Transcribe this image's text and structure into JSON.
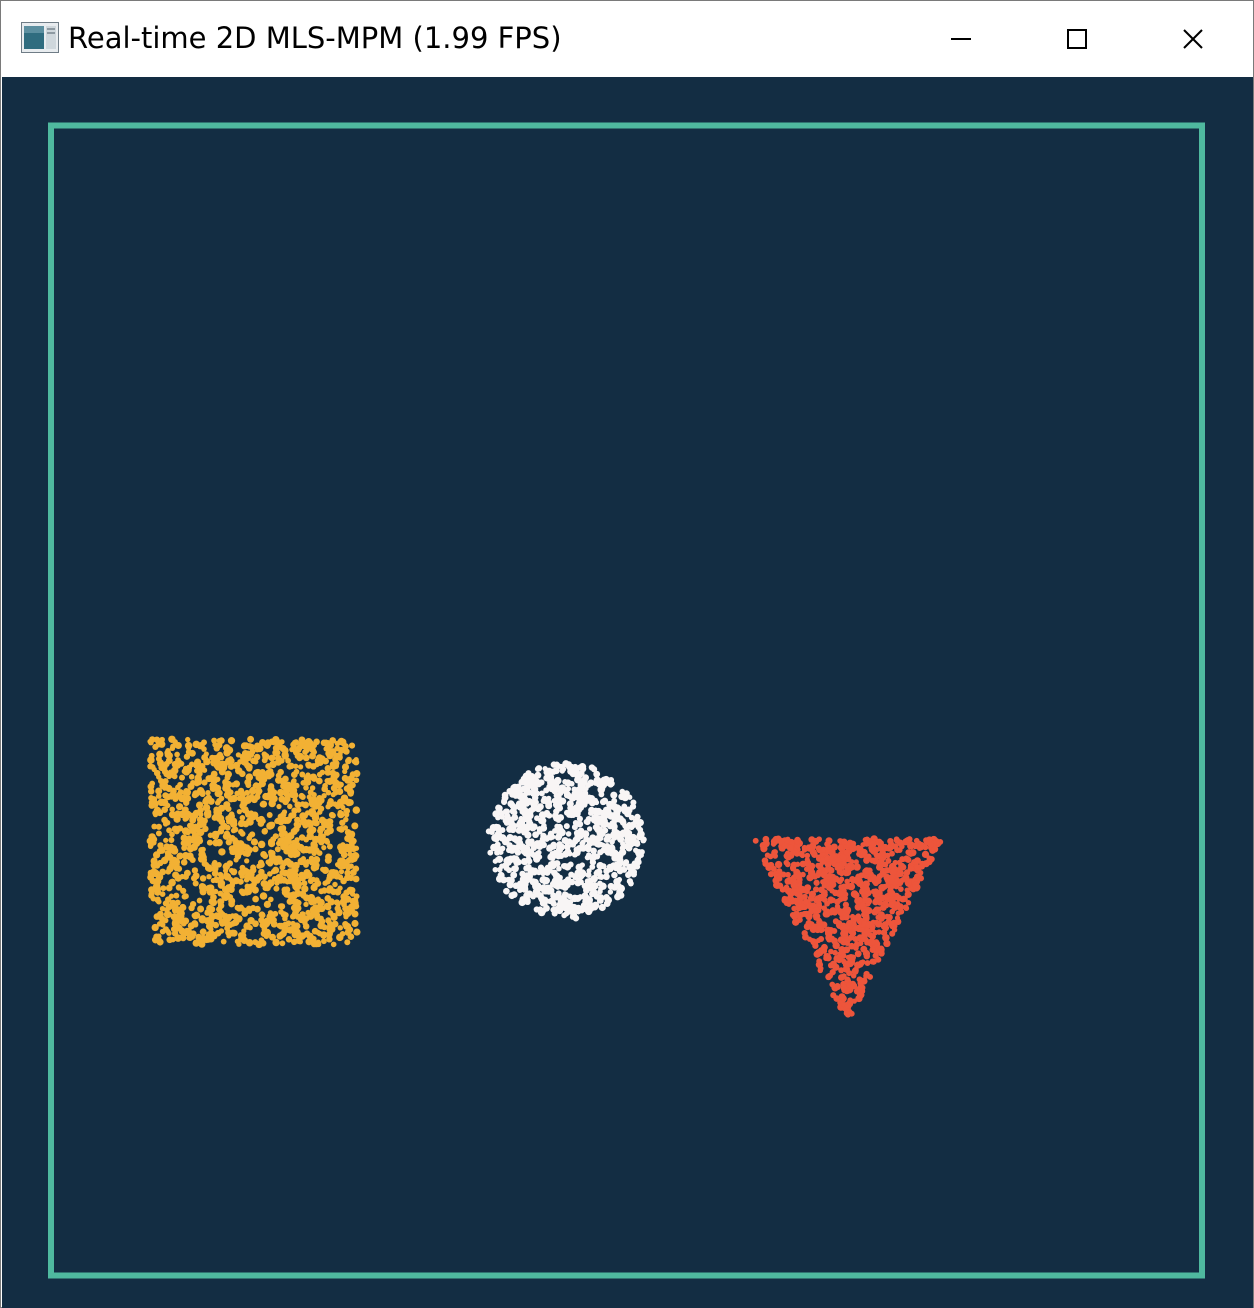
{
  "window": {
    "title": "Real-time 2D MLS-MPM (1.99 FPS)",
    "icon": "app-window-icon",
    "controls": {
      "minimize_icon": "minimize-icon",
      "maximize_icon": "maximize-icon",
      "close_icon": "close-icon"
    }
  },
  "canvas": {
    "background_color": "#132d43",
    "boundary_color": "#4fb99f",
    "shapes": [
      {
        "name": "square-particles",
        "shape": "square",
        "color": "#f2b134"
      },
      {
        "name": "circle-particles",
        "shape": "circle",
        "color": "#f8f5f5"
      },
      {
        "name": "triangle-particles",
        "shape": "triangle",
        "color": "#ed553b"
      }
    ]
  }
}
